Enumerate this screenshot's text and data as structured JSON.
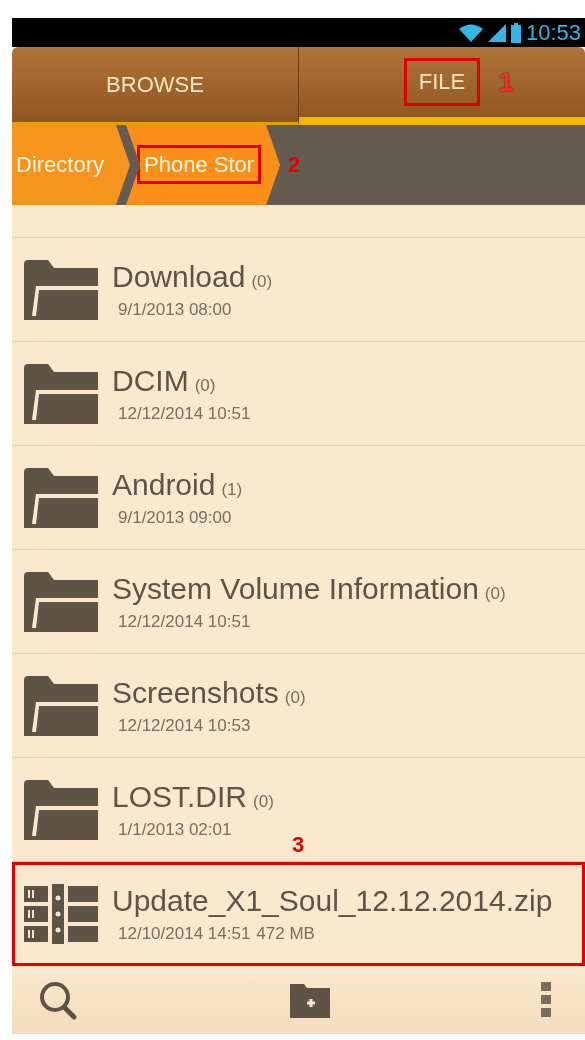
{
  "status_bar": {
    "time": "10:53"
  },
  "tabs": [
    {
      "label": "BROWSE",
      "selected": false
    },
    {
      "label": "FILE",
      "selected": true,
      "callout": "1"
    }
  ],
  "breadcrumbs": [
    {
      "label": "Directory",
      "selected": false
    },
    {
      "label": "Phone Stor",
      "selected": true,
      "callout": "2"
    }
  ],
  "files": [
    {
      "kind": "folder",
      "name": "Download",
      "count": "(0)",
      "date": "9/1/2013 08:00"
    },
    {
      "kind": "folder",
      "name": "DCIM",
      "count": "(0)",
      "date": "12/12/2014 10:51"
    },
    {
      "kind": "folder",
      "name": "Android",
      "count": "(1)",
      "date": "9/1/2013 09:00"
    },
    {
      "kind": "folder",
      "name": "System Volume Information",
      "count": "(0)",
      "date": "12/12/2014 10:51"
    },
    {
      "kind": "folder",
      "name": "Screenshots",
      "count": "(0)",
      "date": "12/12/2014 10:53"
    },
    {
      "kind": "folder",
      "name": "LOST.DIR",
      "count": "(0)",
      "date": "1/1/2013 02:01"
    },
    {
      "kind": "archive",
      "name": "Update_X1_Soul_12.12.2014.zip",
      "date": "12/10/2014 14:51",
      "size": "472 MB",
      "callout": "3"
    }
  ]
}
